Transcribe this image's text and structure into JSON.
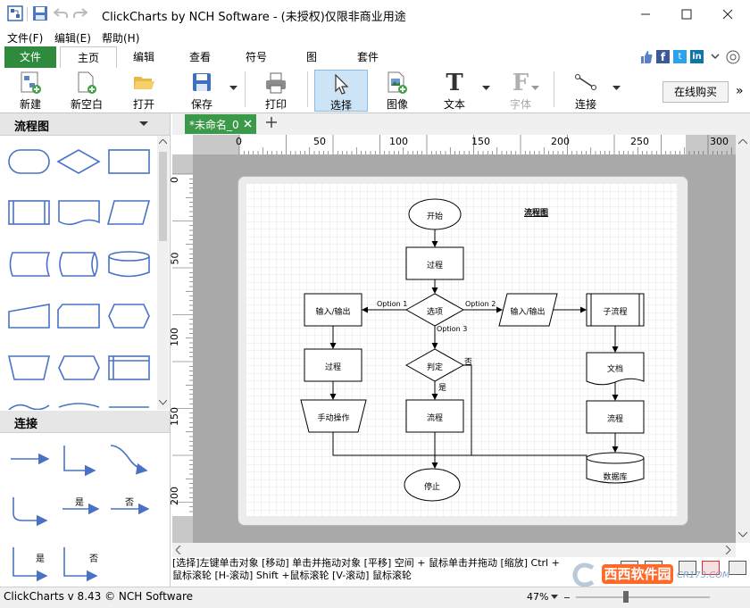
{
  "window": {
    "title": "ClickCharts by NCH Software - (未授权)仅限非商业用途",
    "minimize_icon": "minimize-icon",
    "maximize_icon": "maximize-icon",
    "close_icon": "close-icon"
  },
  "menubar": {
    "items": [
      "文件(F)",
      "编辑(E)",
      "帮助(H)"
    ]
  },
  "ribbon_tabs": [
    "文件",
    "主页",
    "编辑",
    "查看",
    "符号",
    "图",
    "套件"
  ],
  "ribbon_active_tab": "主页",
  "ribbon": {
    "buttons": [
      "新建",
      "新空白",
      "打开",
      "保存",
      "打印",
      "选择",
      "图像",
      "文本",
      "字体",
      "连接"
    ],
    "buy_online": "在线购买"
  },
  "left_panel": {
    "shapes_title": "流程图",
    "connectors_title": "连接",
    "connector_labels": {
      "yes": "是",
      "no": "否"
    }
  },
  "document": {
    "tab_label": "*未命名_0",
    "ruler_h": [
      "0",
      "50",
      "100",
      "150",
      "200",
      "250",
      "300"
    ],
    "ruler_v": [
      "0",
      "50",
      "100",
      "150",
      "200"
    ]
  },
  "flowchart": {
    "title": "流程图",
    "nodes": {
      "start": "开始",
      "process1": "过程",
      "io_left": "输入/输出",
      "decision": "选项",
      "io_right": "输入/输出",
      "subprocess": "子流程",
      "process2": "过程",
      "judge": "判定",
      "document": "文档",
      "manual": "手动操作",
      "flow_mid": "流程",
      "flow_right": "流程",
      "database": "数据库",
      "end": "停止"
    },
    "labels": {
      "option1": "Option 1",
      "option2": "Option 2",
      "option3": "Option 3",
      "yes": "是",
      "no": "否"
    }
  },
  "hint": {
    "line1": "[选择]左键单击对象 [移动] 单击并拖动对象 [平移] 空间 + 鼠标单击并拖动 [缩放] Ctrl +",
    "line2": "鼠标滚轮 [H-滚动] Shift +鼠标滚轮 [V-滚动] 鼠标滚轮"
  },
  "status": {
    "app": "ClickCharts v 8.43 © NCH Software",
    "zoom": "47%"
  },
  "watermark": {
    "text": "西西软件园",
    "sub": "CR173.COM"
  }
}
